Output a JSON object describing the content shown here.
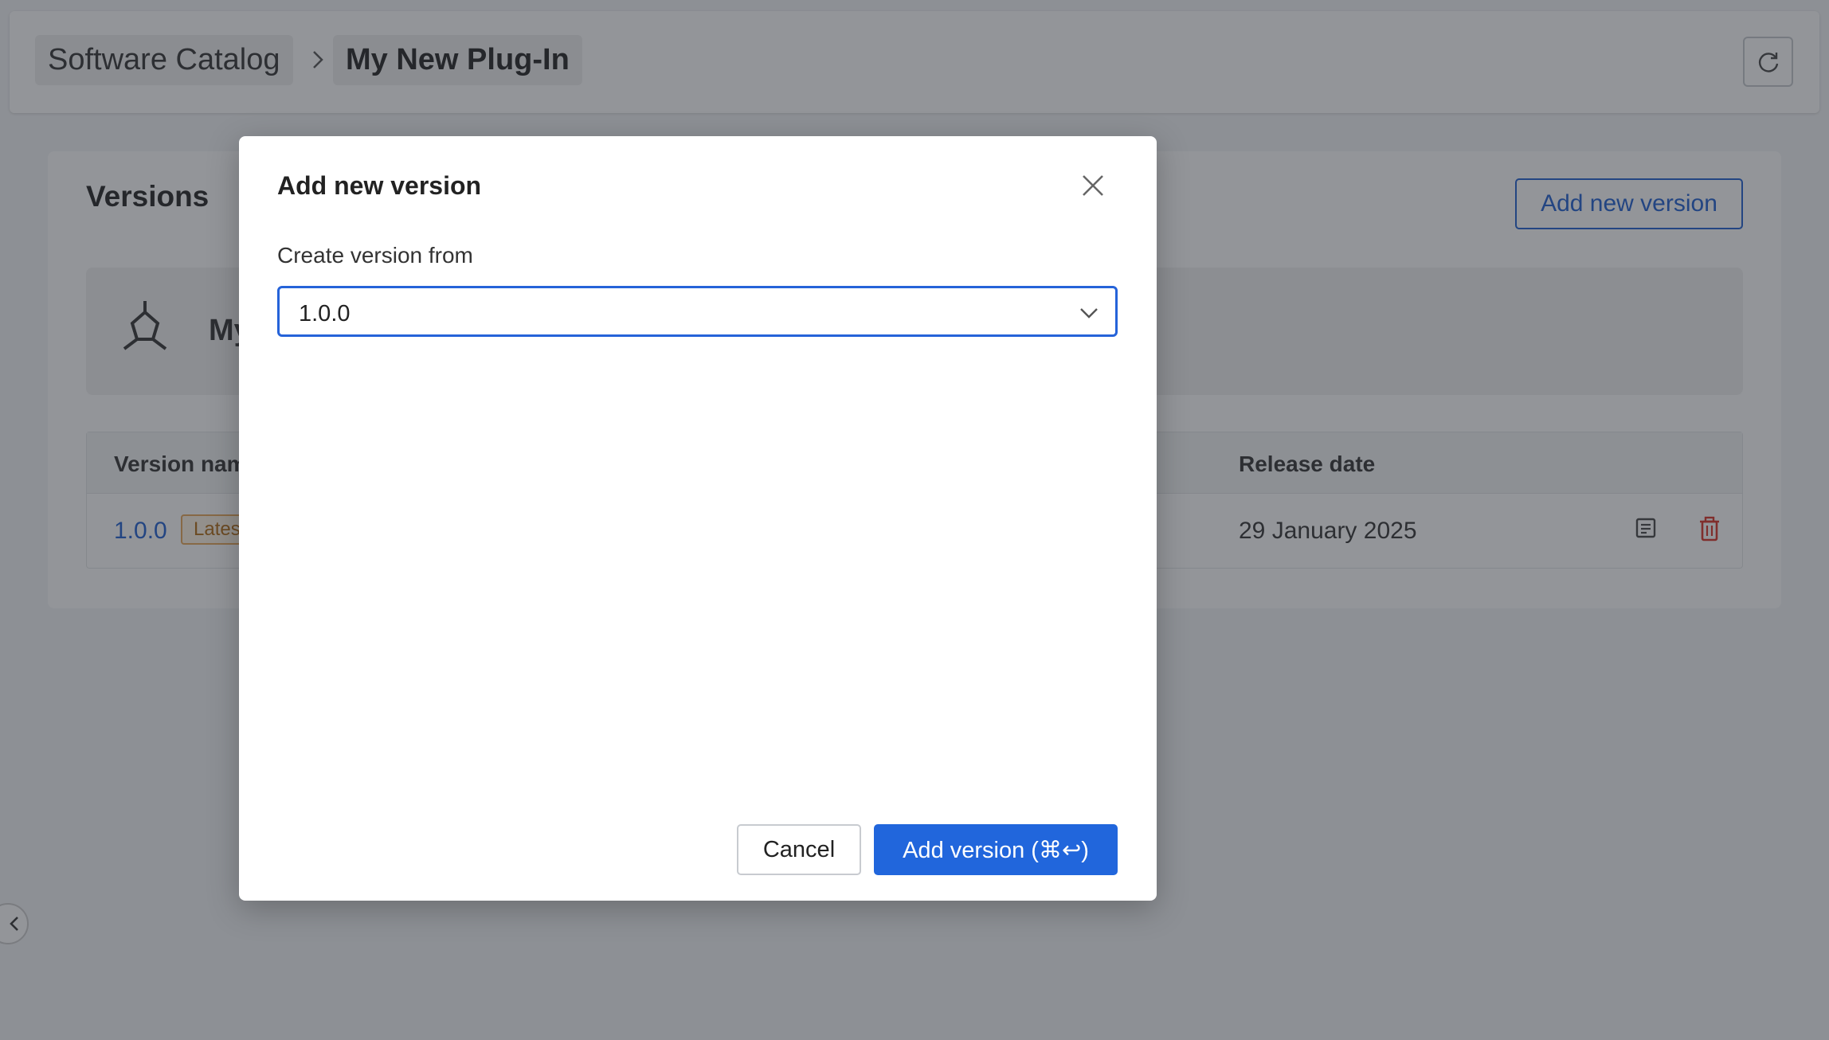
{
  "breadcrumb": {
    "items": [
      "Software Catalog",
      "My New Plug-In"
    ],
    "separator": "›"
  },
  "versions_panel": {
    "title": "Versions",
    "add_button_label": "Add new version",
    "plugin_name_visible": "My"
  },
  "table": {
    "columns": [
      "Version nam",
      "Release date"
    ],
    "rows": [
      {
        "version": "1.0.0",
        "badge": "Lates",
        "release_date": "29 January 2025"
      }
    ]
  },
  "modal": {
    "title": "Add new version",
    "field_label": "Create version from",
    "selected_value": "1.0.0",
    "cancel_label": "Cancel",
    "confirm_label": "Add version (⌘↩)"
  },
  "colors": {
    "accent": "#2166dc",
    "link": "#1f5fd1",
    "danger": "#d93025",
    "badge_border": "#e7a659"
  },
  "icons": [
    "refresh-icon",
    "chevron-right-icon",
    "plugin-hex-icon",
    "notes-icon",
    "trash-icon",
    "close-icon",
    "chevron-down-icon",
    "chevron-left-icon"
  ]
}
